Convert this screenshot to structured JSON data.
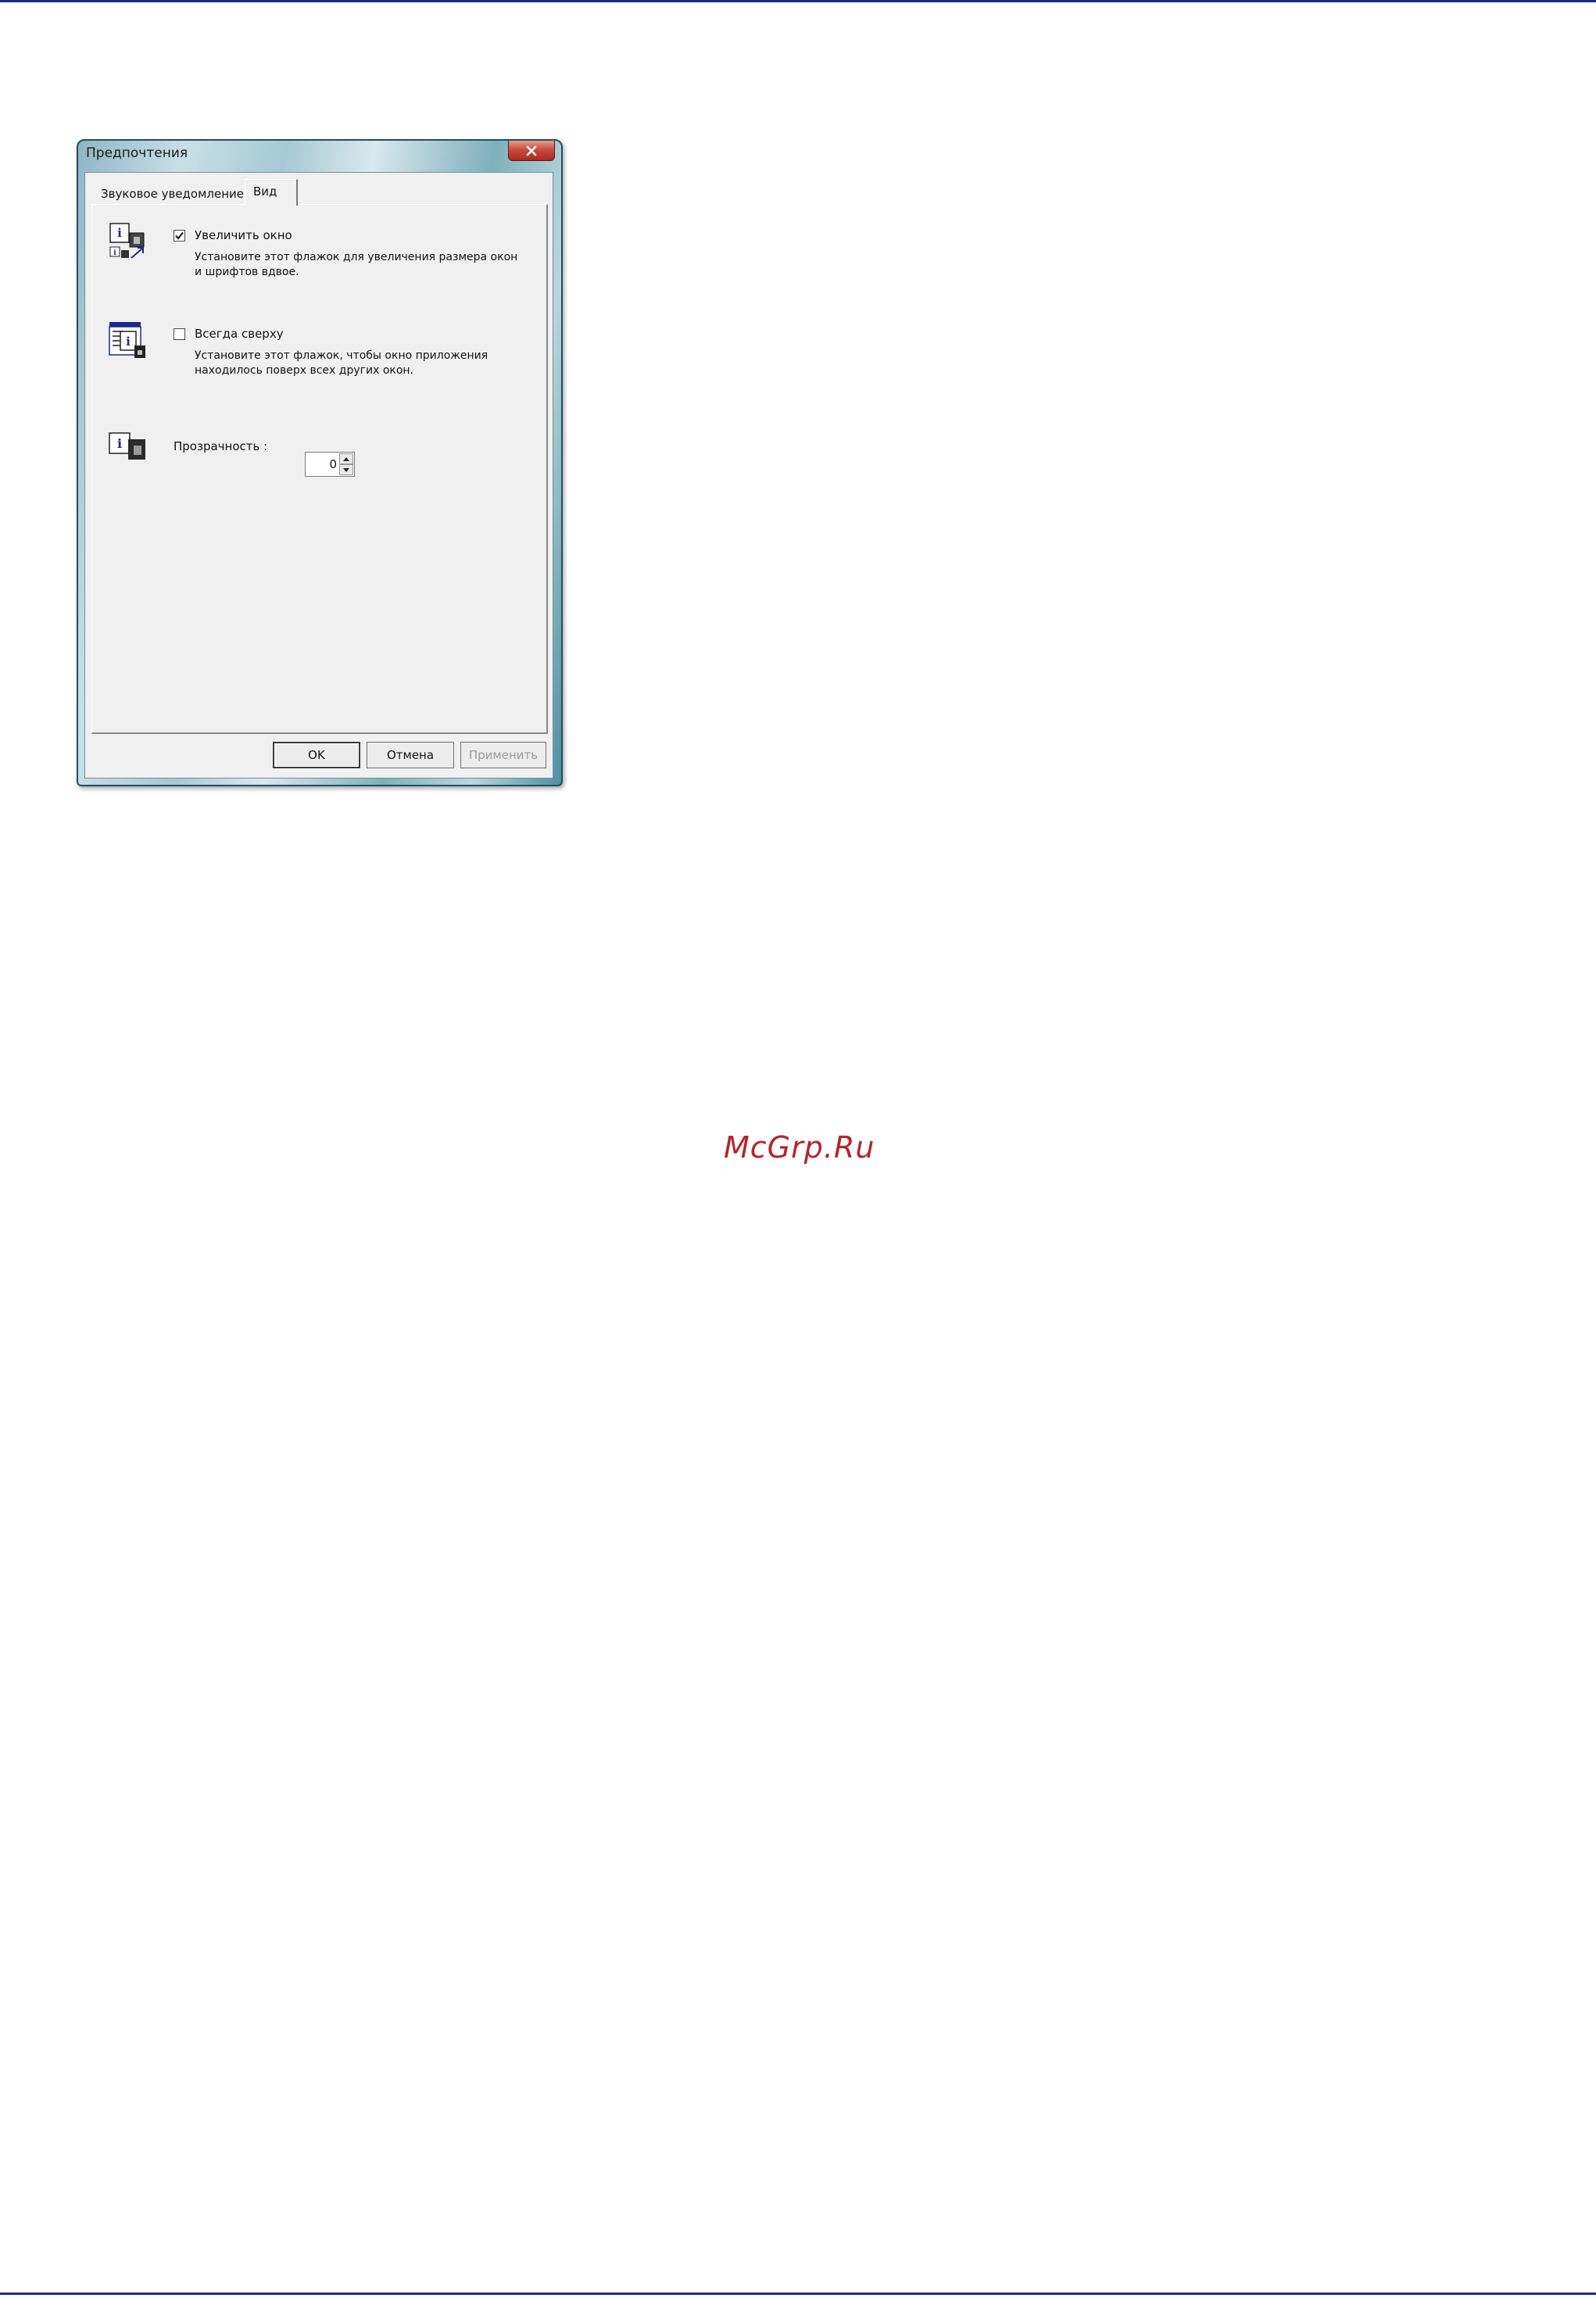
{
  "window": {
    "title": "Предпочтения",
    "close_label": "Закрыть"
  },
  "tabs": [
    {
      "label": "Звуковое уведомление",
      "active": false
    },
    {
      "label": "Вид",
      "active": true
    }
  ],
  "options": {
    "enlarge": {
      "label": "Увеличить окно",
      "checked": true,
      "description": "Установите этот флажок для увеличения размера окон и шрифтов вдвое.",
      "icon": "enlarge-window-icon"
    },
    "always_on_top": {
      "label": "Всегда сверху",
      "checked": false,
      "description": "Установите этот флажок, чтобы окно приложения находилось поверх всех других окон.",
      "icon": "always-on-top-icon"
    },
    "transparency": {
      "label": "Прозрачность :",
      "value": "0",
      "icon": "transparency-icon"
    }
  },
  "buttons": {
    "ok": "OK",
    "cancel": "Отмена",
    "apply": "Применить"
  },
  "watermark": "McGrp.Ru",
  "colors": {
    "page_rule": "#1a2a8a",
    "dialog_face": "#f0f0f0",
    "watermark": "#b5232e",
    "close_button": "#c8473a"
  }
}
